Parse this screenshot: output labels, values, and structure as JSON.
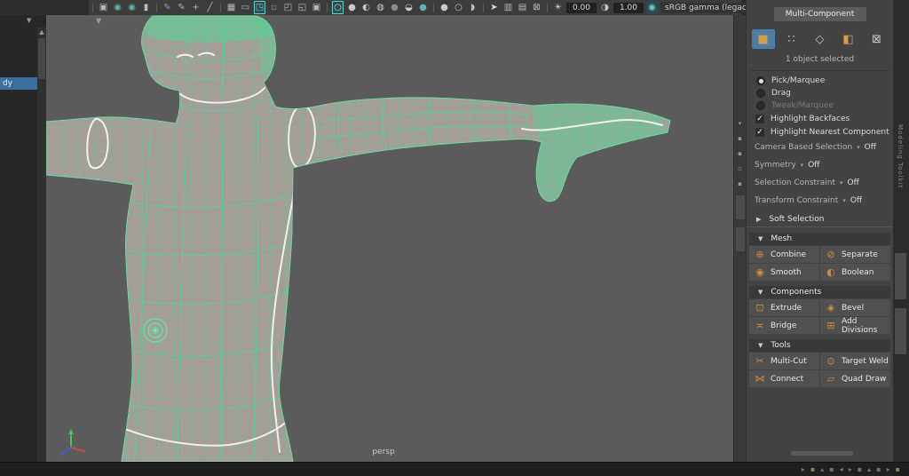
{
  "colors": {
    "wireframe_green": "#58d79a",
    "selection_blue": "#4d7ca6",
    "icon_orange": "#d08a3c",
    "viewport_bg": "#5b5b5b",
    "panel_bg": "#434343"
  },
  "glyphs": {
    "collapse_arrow": "▼",
    "expand_arrow": "▶",
    "dropdown_arrow": "▾",
    "up_arrow": "▲",
    "check": "✓"
  },
  "topbar": {
    "items": [
      {
        "type": "sep"
      },
      {
        "type": "icon",
        "name": "select-camera-icon",
        "glyph": "▣",
        "color": "#b9b9b9"
      },
      {
        "type": "icon",
        "name": "lock-camera-icon",
        "glyph": "◉",
        "color": "#5fb3ab"
      },
      {
        "type": "icon",
        "name": "camera-attributes-icon",
        "glyph": "◉",
        "color": "#5fb3ab"
      },
      {
        "type": "icon",
        "name": "bookmarks-icon",
        "glyph": "▮",
        "color": "#b9b9b9"
      },
      {
        "type": "sep"
      },
      {
        "type": "icon",
        "name": "image-plane-icon",
        "glyph": "✎",
        "color": "#7fa3c9"
      },
      {
        "type": "icon",
        "name": "pan-zoom-icon",
        "glyph": "✎",
        "color": "#9fb3c9"
      },
      {
        "type": "icon",
        "name": "move-icon",
        "glyph": "+",
        "color": "#b9b9b9"
      },
      {
        "type": "icon",
        "name": "measure-icon",
        "glyph": "╱",
        "color": "#b9b9b9"
      },
      {
        "type": "sep"
      },
      {
        "type": "icon",
        "name": "grid-icon",
        "glyph": "▦",
        "color": "#b9b9b9"
      },
      {
        "type": "icon",
        "name": "film-gate-icon",
        "glyph": "▭",
        "color": "#b9b9b9"
      },
      {
        "type": "icon",
        "name": "resolution-gate-icon",
        "glyph": "◳",
        "color": "#6fc0c9",
        "active": true
      },
      {
        "type": "icon",
        "name": "gate-mask-icon",
        "glyph": "▫",
        "color": "#8a8a8a"
      },
      {
        "type": "icon",
        "name": "safe-action-icon",
        "glyph": "◰",
        "color": "#b9b9b9"
      },
      {
        "type": "icon",
        "name": "safe-title-icon",
        "glyph": "◱",
        "color": "#b9b9b9"
      },
      {
        "type": "icon",
        "name": "field-chart-icon",
        "glyph": "▣",
        "color": "#b9b9b9"
      },
      {
        "type": "sep"
      },
      {
        "type": "icon",
        "name": "wireframe-display-icon",
        "glyph": "○",
        "color": "#d9d9d9",
        "active": true
      },
      {
        "type": "icon",
        "name": "shaded-display-icon",
        "glyph": "●",
        "color": "#c9c9c9"
      },
      {
        "type": "icon",
        "name": "textured-display-icon",
        "glyph": "◐",
        "color": "#c9c9c9"
      },
      {
        "type": "icon",
        "name": "lights-icon",
        "glyph": "◍",
        "color": "#c9c9c9"
      },
      {
        "type": "icon",
        "name": "shadows-icon",
        "glyph": "●",
        "color": "#8a8a8a"
      },
      {
        "type": "icon",
        "name": "ambient-occlusion-icon",
        "glyph": "◒",
        "color": "#c9c9c9"
      },
      {
        "type": "icon",
        "name": "motion-blur-icon",
        "glyph": "●",
        "color": "#5fb3ab"
      },
      {
        "type": "sep"
      },
      {
        "type": "icon",
        "name": "xray-icon",
        "glyph": "●",
        "color": "#c9c9c9"
      },
      {
        "type": "icon",
        "name": "isolate-select-icon",
        "glyph": "○",
        "color": "#c9c9c9"
      },
      {
        "type": "icon",
        "name": "fx-icon",
        "glyph": "◗",
        "color": "#b9b9b9"
      },
      {
        "type": "sep"
      },
      {
        "type": "icon",
        "name": "cursor-icon",
        "glyph": "➤",
        "color": "#d9d9d9"
      },
      {
        "type": "icon",
        "name": "snapshot-icon",
        "glyph": "▥",
        "color": "#b9b9b9"
      },
      {
        "type": "icon",
        "name": "snapshot-bake-icon",
        "glyph": "▤",
        "color": "#b9b9b9"
      },
      {
        "type": "icon",
        "name": "no-image-icon",
        "glyph": "⊠",
        "color": "#b9b9b9"
      },
      {
        "type": "sep"
      },
      {
        "type": "icon",
        "name": "exposure-icon",
        "glyph": "☀",
        "color": "#c9c9c9"
      },
      {
        "type": "field",
        "name": "exposure-field",
        "value": "0.00"
      },
      {
        "type": "icon",
        "name": "gamma-icon",
        "glyph": "◑",
        "color": "#c9c9c9"
      },
      {
        "type": "field",
        "name": "gamma-field",
        "value": "1.00"
      },
      {
        "type": "icon",
        "name": "view-transform-icon",
        "glyph": "◉",
        "color": "#5fd3c8",
        "boxed": true
      },
      {
        "type": "dropdown",
        "name": "view-transform-select",
        "value": "sRGB gamma (legacy)"
      }
    ]
  },
  "left_panel": {
    "selected_item": "dy"
  },
  "viewport": {
    "camera_label": "persp"
  },
  "side_strip": {
    "icons": [
      "▾",
      "▪",
      "▪",
      "▫",
      "▪"
    ],
    "boxes": 2
  },
  "toolkit": {
    "tab": "Multi-Component",
    "status": "1 object selected",
    "modes": [
      {
        "name": "object-mode-icon",
        "glyph": "■",
        "color": "#d79b4a",
        "selected": true
      },
      {
        "name": "vertex-mode-icon",
        "glyph": "∷",
        "color": "#cdb9a0",
        "selected": false
      },
      {
        "name": "edge-mode-icon",
        "glyph": "◇",
        "color": "#cdb9a0",
        "selected": false
      },
      {
        "name": "face-mode-icon",
        "glyph": "◧",
        "color": "#d79b4a",
        "selected": false
      },
      {
        "name": "multi-component-mode-icon",
        "glyph": "⊠",
        "color": "#cccccc",
        "selected": false
      }
    ],
    "radios": [
      {
        "label": "Pick/Marquee",
        "state": "selected"
      },
      {
        "label": "Drag",
        "state": "unselected"
      },
      {
        "label": "Tweak/Marquee",
        "state": "disabled"
      }
    ],
    "checkboxes": [
      {
        "label": "Highlight Backfaces",
        "checked": true
      },
      {
        "label": "Highlight Nearest Component",
        "checked": true
      }
    ],
    "dropdown_rows": [
      {
        "label": "Camera Based Selection",
        "value": "Off"
      },
      {
        "label": "Symmetry",
        "value": "Off"
      },
      {
        "label": "Selection Constraint",
        "value": "Off"
      },
      {
        "label": "Transform Constraint",
        "value": "Off"
      }
    ],
    "soft_selection": "Soft Selection",
    "sections": [
      {
        "title": "Mesh",
        "buttons": [
          {
            "label": "Combine",
            "icon": "combine-icon",
            "glyph": "⊕"
          },
          {
            "label": "Separate",
            "icon": "separate-icon",
            "glyph": "⊘"
          },
          {
            "label": "Smooth",
            "icon": "smooth-icon",
            "glyph": "◉"
          },
          {
            "label": "Boolean",
            "icon": "boolean-icon",
            "glyph": "◐"
          }
        ]
      },
      {
        "title": "Components",
        "buttons": [
          {
            "label": "Extrude",
            "icon": "extrude-icon",
            "glyph": "⊡"
          },
          {
            "label": "Bevel",
            "icon": "bevel-icon",
            "glyph": "◈"
          },
          {
            "label": "Bridge",
            "icon": "bridge-icon",
            "glyph": "≍"
          },
          {
            "label": "Add Divisions",
            "icon": "add-divisions-icon",
            "glyph": "⊞"
          }
        ]
      },
      {
        "title": "Tools",
        "buttons": [
          {
            "label": "Multi-Cut",
            "icon": "multi-cut-icon",
            "glyph": "✂"
          },
          {
            "label": "Target Weld",
            "icon": "target-weld-icon",
            "glyph": "⊙"
          },
          {
            "label": "Connect",
            "icon": "connect-icon",
            "glyph": "⋈"
          },
          {
            "label": "Quad Draw",
            "icon": "quad-draw-icon",
            "glyph": "▱"
          }
        ]
      }
    ]
  },
  "right_tabs": {
    "vertical_label": "Modeling Toolkit"
  },
  "status_bar": {
    "icons": [
      "▸",
      "▪",
      "▴",
      "▪",
      "◂",
      "▸",
      "▪",
      "▴",
      "▪",
      "▸",
      "▪"
    ]
  }
}
